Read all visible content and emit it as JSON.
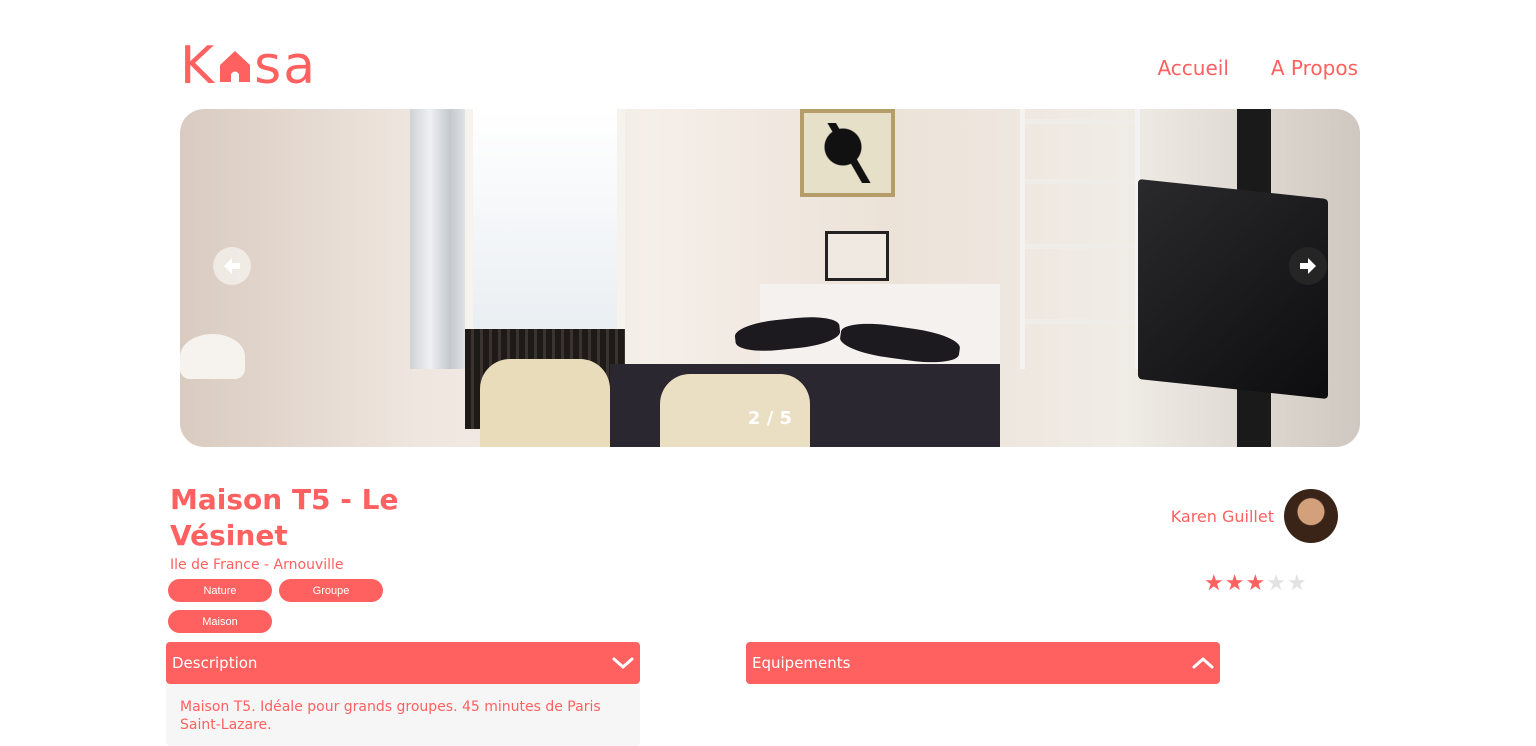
{
  "brand": {
    "logo_left": "K",
    "logo_right": "sa",
    "logo_icon": "house-icon",
    "color": "#FF6060"
  },
  "nav": {
    "home": "Accueil",
    "about": "A Propos"
  },
  "slideshow": {
    "counter": "2 / 5",
    "prev_icon": "arrow-left-icon",
    "next_icon": "arrow-right-icon"
  },
  "listing": {
    "title": "Maison T5 - Le Vésinet",
    "location": "Ile de France - Arnouville",
    "tags": [
      "Nature",
      "Groupe",
      "Maison"
    ]
  },
  "host": {
    "name": "Karen Guillet"
  },
  "rating": {
    "value": 3,
    "max": 5
  },
  "collapses": {
    "description": {
      "label": "Description",
      "icon": "chevron-down-icon",
      "text": "Maison T5. Idéale pour grands groupes. 45 minutes de Paris Saint-Lazare."
    },
    "equipments": {
      "label": "Equipements",
      "icon": "chevron-up-icon"
    }
  }
}
